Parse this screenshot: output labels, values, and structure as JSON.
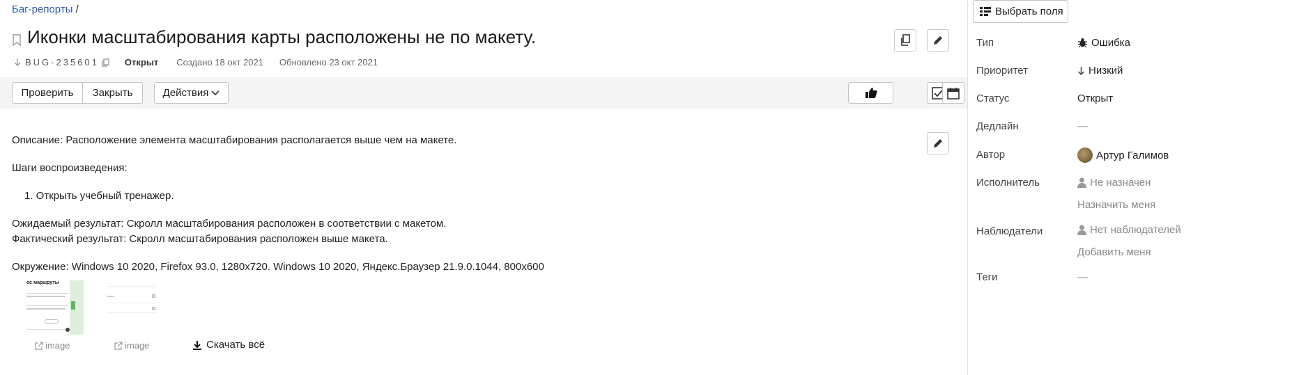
{
  "breadcrumb": {
    "link": "Баг-репорты",
    "sep": "/"
  },
  "issue": {
    "title": "Иконки масштабирования карты расположены не по макету.",
    "key": "BUG-235601",
    "status": "Открыт",
    "created": "Создано 18 окт 2021",
    "updated": "Обновлено 23 окт 2021"
  },
  "toolbar": {
    "check_label": "Проверить",
    "close_label": "Закрыть",
    "actions_label": "Действия"
  },
  "description": {
    "line1": "Описание: Расположение элемента масштабирования располагается выше чем на макете.",
    "line2": "Шаги воспроизведения:",
    "step1": "1. Открыть учебный тренажер.",
    "line3": "Ожидаемый результат: Скролл масштабирования расположен в соответствии с макетом.",
    "line4": "Фактический результат: Скролл масштабирования расположен выше макета.",
    "line5": "Окружение: Windows 10 2020, Firefox 93.0, 1280x720. Windows 10 2020, Яндекс.Браузер 21.9.0.1044, 800x600"
  },
  "attachments": {
    "items": [
      {
        "label": "image"
      },
      {
        "label": "image"
      }
    ],
    "thumb1_heading": "ос маршруты",
    "download_label": "Скачать всё"
  },
  "sidebar": {
    "select_fields_label": "Выбрать поля",
    "type": {
      "label": "Тип",
      "value": "Ошибка"
    },
    "priority": {
      "label": "Приоритет",
      "value": "Низкий"
    },
    "status": {
      "label": "Статус",
      "value": "Открыт"
    },
    "deadline": {
      "label": "Дедлайн",
      "value": "—"
    },
    "author": {
      "label": "Автор",
      "value": "Артур Галимов"
    },
    "assignee": {
      "label": "Исполнитель",
      "value": "Не назначен",
      "action": "Назначить меня"
    },
    "watchers": {
      "label": "Наблюдатели",
      "value": "Нет наблюдателей",
      "action": "Добавить меня"
    },
    "tags": {
      "label": "Теги",
      "value": "—"
    }
  },
  "colors": {
    "link": "#2f5ba8",
    "toolbar_bg": "#f4f4f4",
    "border": "#c4c4c4"
  }
}
